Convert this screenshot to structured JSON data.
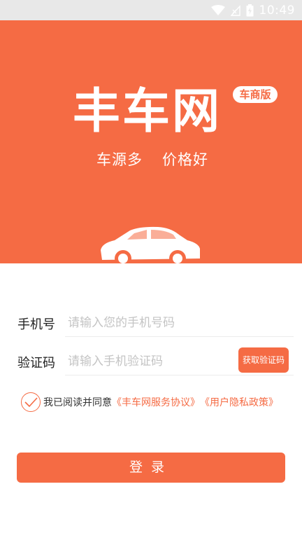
{
  "status_bar": {
    "time": "10:49",
    "icons": [
      "wifi-icon",
      "signal-off-icon",
      "battery-charging-icon"
    ]
  },
  "hero": {
    "brand": "丰车网",
    "badge": "车商版",
    "slogan_left": "车源多",
    "slogan_right": "价格好",
    "background_color": "#f56b44"
  },
  "form": {
    "phone_label": "手机号",
    "phone_placeholder": "请输入您的手机号码",
    "code_label": "验证码",
    "code_placeholder": "请输入手机验证码",
    "get_code_button": "获取验证码"
  },
  "agreement": {
    "checked": true,
    "text": "我已阅读并同意",
    "service_link": "《丰车网服务协议》",
    "privacy_link": "《用户隐私政策》"
  },
  "login_button": "登录",
  "accent_color": "#f56b44"
}
